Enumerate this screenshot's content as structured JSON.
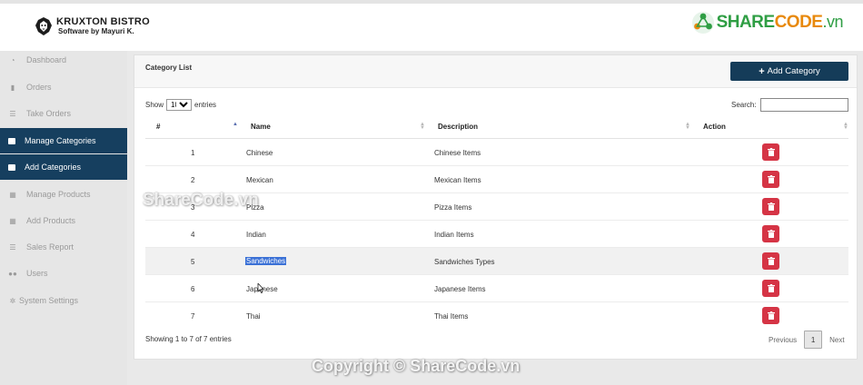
{
  "app": {
    "brand_name": "KRUXTON BISTRO",
    "brand_sub": "Software by Mayuri K."
  },
  "watermark": {
    "logo_prefix": "SHARE",
    "logo_code": "CODE",
    "logo_suffix": ".vn",
    "middle": "ShareCode.vn",
    "bottom": "Copyright © ShareCode.vn"
  },
  "sidebar": {
    "items": [
      {
        "label": "Dashboard",
        "icon": "gauge-icon",
        "active": false
      },
      {
        "label": "Orders",
        "icon": "clipboard-icon",
        "active": false
      },
      {
        "label": "Take Orders",
        "icon": "list-icon",
        "active": false
      },
      {
        "label": "Manage Categories",
        "icon": "square-icon",
        "active": true
      },
      {
        "label": "Add Categories",
        "icon": "square-icon",
        "active": true
      },
      {
        "label": "Manage Products",
        "icon": "grid-icon",
        "active": false
      },
      {
        "label": "Add Products",
        "icon": "grid-icon",
        "active": false
      },
      {
        "label": "Sales Report",
        "icon": "list-icon",
        "active": false
      },
      {
        "label": "Users",
        "icon": "users-icon",
        "active": false
      },
      {
        "label": "System Settings",
        "icon": "gears-icon",
        "active": false
      }
    ]
  },
  "main": {
    "title": "Category List",
    "add_button": "Add Category",
    "show_label": "Show",
    "show_value": "10",
    "entries_label": "entries",
    "search_label": "Search:",
    "columns": [
      "#",
      "Name",
      "Description",
      "Action"
    ],
    "rows": [
      {
        "id": "1",
        "name": "Chinese",
        "description": "Chinese Items"
      },
      {
        "id": "2",
        "name": "Mexican",
        "description": "Mexican Items"
      },
      {
        "id": "3",
        "name": "Pizza",
        "description": "Pizza Items"
      },
      {
        "id": "4",
        "name": "Indian",
        "description": "Indian Items"
      },
      {
        "id": "5",
        "name": "Sandwiches",
        "description": "Sandwiches Types"
      },
      {
        "id": "6",
        "name": "Japanese",
        "description": "Japanese Items"
      },
      {
        "id": "7",
        "name": "Thai",
        "description": "Thai Items"
      }
    ],
    "info": "Showing 1 to 7 of 7 entries",
    "pagination": {
      "previous": "Previous",
      "page": "1",
      "next": "Next"
    }
  },
  "colors": {
    "nav_active": "#163f5f",
    "primary_button": "#153c59",
    "delete_button": "#d53445",
    "selection": "#3b71d6"
  }
}
